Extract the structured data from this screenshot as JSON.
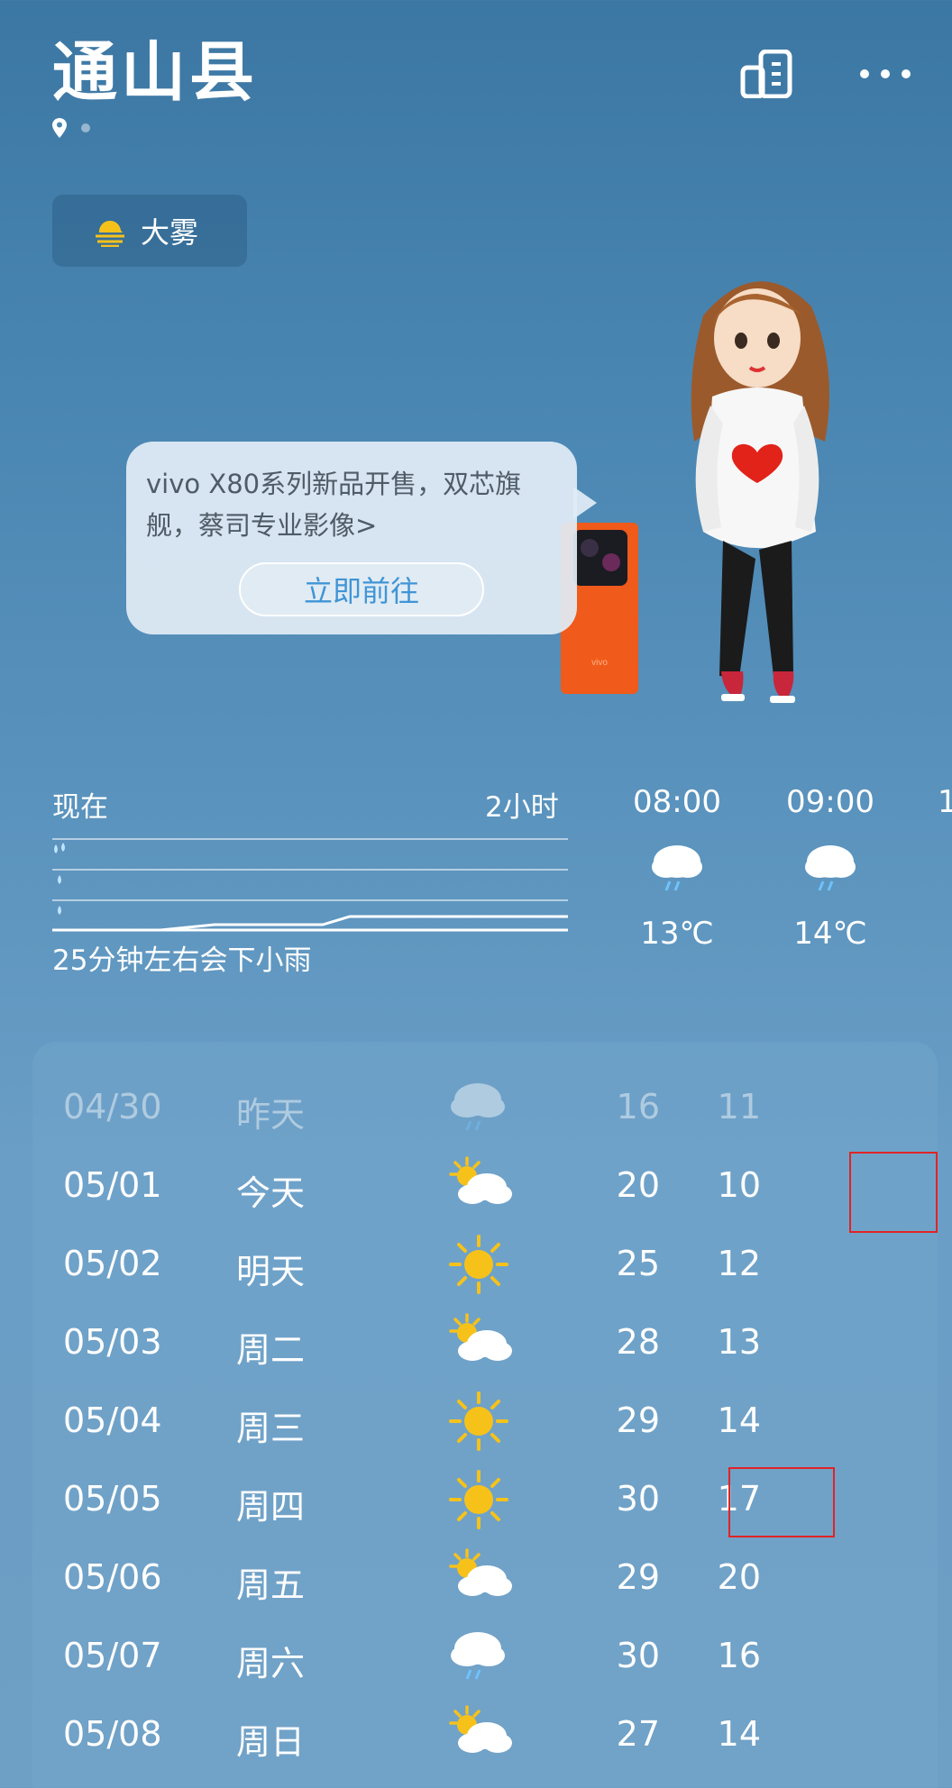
{
  "header": {
    "city": "通山县",
    "condition": "大雾"
  },
  "ad": {
    "text": "vivo X80系列新品开售，双芯旗舰，蔡司专业影像>",
    "button": "立即前往",
    "brand_mark": "vivo"
  },
  "precip": {
    "now_label": "现在",
    "two_hour_label": "2小时",
    "message": "25分钟左右会下小雨"
  },
  "hourly": [
    {
      "time": "08:00",
      "temp": "13℃",
      "icon": "rain-cloud-icon"
    },
    {
      "time": "09:00",
      "temp": "14℃",
      "icon": "rain-cloud-icon"
    },
    {
      "time": "1",
      "temp": "",
      "icon": ""
    }
  ],
  "daily": [
    {
      "date": "04/30",
      "label": "昨天",
      "high": "16",
      "low": "11",
      "icon": "rain-cloud-icon"
    },
    {
      "date": "05/01",
      "label": "今天",
      "high": "20",
      "low": "10",
      "icon": "partly-cloudy-icon"
    },
    {
      "date": "05/02",
      "label": "明天",
      "high": "25",
      "low": "12",
      "icon": "sun-icon"
    },
    {
      "date": "05/03",
      "label": "周二",
      "high": "28",
      "low": "13",
      "icon": "partly-cloudy-icon"
    },
    {
      "date": "05/04",
      "label": "周三",
      "high": "29",
      "low": "14",
      "icon": "sun-icon"
    },
    {
      "date": "05/05",
      "label": "周四",
      "high": "30",
      "low": "17",
      "icon": "sun-icon"
    },
    {
      "date": "05/06",
      "label": "周五",
      "high": "29",
      "low": "20",
      "icon": "partly-cloudy-icon"
    },
    {
      "date": "05/07",
      "label": "周六",
      "high": "30",
      "low": "16",
      "icon": "rain-cloud-icon"
    },
    {
      "date": "05/08",
      "label": "周日",
      "high": "27",
      "low": "14",
      "icon": "partly-cloudy-icon"
    }
  ],
  "highlight": {
    "color": "#e02424"
  }
}
